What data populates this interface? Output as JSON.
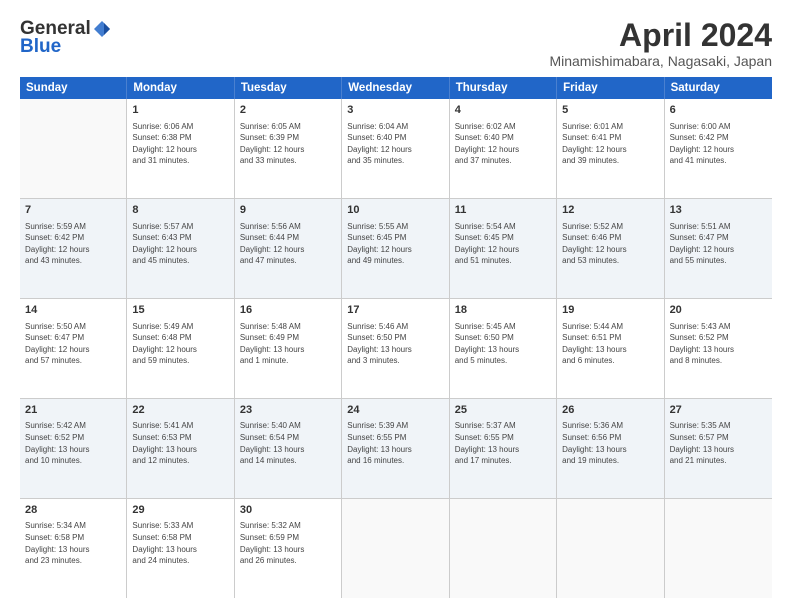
{
  "header": {
    "logo_general": "General",
    "logo_blue": "Blue",
    "title": "April 2024",
    "subtitle": "Minamishimabara, Nagasaki, Japan"
  },
  "calendar": {
    "days_of_week": [
      "Sunday",
      "Monday",
      "Tuesday",
      "Wednesday",
      "Thursday",
      "Friday",
      "Saturday"
    ],
    "rows": [
      [
        {
          "num": "",
          "info": ""
        },
        {
          "num": "1",
          "info": "Sunrise: 6:06 AM\nSunset: 6:38 PM\nDaylight: 12 hours\nand 31 minutes."
        },
        {
          "num": "2",
          "info": "Sunrise: 6:05 AM\nSunset: 6:39 PM\nDaylight: 12 hours\nand 33 minutes."
        },
        {
          "num": "3",
          "info": "Sunrise: 6:04 AM\nSunset: 6:40 PM\nDaylight: 12 hours\nand 35 minutes."
        },
        {
          "num": "4",
          "info": "Sunrise: 6:02 AM\nSunset: 6:40 PM\nDaylight: 12 hours\nand 37 minutes."
        },
        {
          "num": "5",
          "info": "Sunrise: 6:01 AM\nSunset: 6:41 PM\nDaylight: 12 hours\nand 39 minutes."
        },
        {
          "num": "6",
          "info": "Sunrise: 6:00 AM\nSunset: 6:42 PM\nDaylight: 12 hours\nand 41 minutes."
        }
      ],
      [
        {
          "num": "7",
          "info": "Sunrise: 5:59 AM\nSunset: 6:42 PM\nDaylight: 12 hours\nand 43 minutes."
        },
        {
          "num": "8",
          "info": "Sunrise: 5:57 AM\nSunset: 6:43 PM\nDaylight: 12 hours\nand 45 minutes."
        },
        {
          "num": "9",
          "info": "Sunrise: 5:56 AM\nSunset: 6:44 PM\nDaylight: 12 hours\nand 47 minutes."
        },
        {
          "num": "10",
          "info": "Sunrise: 5:55 AM\nSunset: 6:45 PM\nDaylight: 12 hours\nand 49 minutes."
        },
        {
          "num": "11",
          "info": "Sunrise: 5:54 AM\nSunset: 6:45 PM\nDaylight: 12 hours\nand 51 minutes."
        },
        {
          "num": "12",
          "info": "Sunrise: 5:52 AM\nSunset: 6:46 PM\nDaylight: 12 hours\nand 53 minutes."
        },
        {
          "num": "13",
          "info": "Sunrise: 5:51 AM\nSunset: 6:47 PM\nDaylight: 12 hours\nand 55 minutes."
        }
      ],
      [
        {
          "num": "14",
          "info": "Sunrise: 5:50 AM\nSunset: 6:47 PM\nDaylight: 12 hours\nand 57 minutes."
        },
        {
          "num": "15",
          "info": "Sunrise: 5:49 AM\nSunset: 6:48 PM\nDaylight: 12 hours\nand 59 minutes."
        },
        {
          "num": "16",
          "info": "Sunrise: 5:48 AM\nSunset: 6:49 PM\nDaylight: 13 hours\nand 1 minute."
        },
        {
          "num": "17",
          "info": "Sunrise: 5:46 AM\nSunset: 6:50 PM\nDaylight: 13 hours\nand 3 minutes."
        },
        {
          "num": "18",
          "info": "Sunrise: 5:45 AM\nSunset: 6:50 PM\nDaylight: 13 hours\nand 5 minutes."
        },
        {
          "num": "19",
          "info": "Sunrise: 5:44 AM\nSunset: 6:51 PM\nDaylight: 13 hours\nand 6 minutes."
        },
        {
          "num": "20",
          "info": "Sunrise: 5:43 AM\nSunset: 6:52 PM\nDaylight: 13 hours\nand 8 minutes."
        }
      ],
      [
        {
          "num": "21",
          "info": "Sunrise: 5:42 AM\nSunset: 6:52 PM\nDaylight: 13 hours\nand 10 minutes."
        },
        {
          "num": "22",
          "info": "Sunrise: 5:41 AM\nSunset: 6:53 PM\nDaylight: 13 hours\nand 12 minutes."
        },
        {
          "num": "23",
          "info": "Sunrise: 5:40 AM\nSunset: 6:54 PM\nDaylight: 13 hours\nand 14 minutes."
        },
        {
          "num": "24",
          "info": "Sunrise: 5:39 AM\nSunset: 6:55 PM\nDaylight: 13 hours\nand 16 minutes."
        },
        {
          "num": "25",
          "info": "Sunrise: 5:37 AM\nSunset: 6:55 PM\nDaylight: 13 hours\nand 17 minutes."
        },
        {
          "num": "26",
          "info": "Sunrise: 5:36 AM\nSunset: 6:56 PM\nDaylight: 13 hours\nand 19 minutes."
        },
        {
          "num": "27",
          "info": "Sunrise: 5:35 AM\nSunset: 6:57 PM\nDaylight: 13 hours\nand 21 minutes."
        }
      ],
      [
        {
          "num": "28",
          "info": "Sunrise: 5:34 AM\nSunset: 6:58 PM\nDaylight: 13 hours\nand 23 minutes."
        },
        {
          "num": "29",
          "info": "Sunrise: 5:33 AM\nSunset: 6:58 PM\nDaylight: 13 hours\nand 24 minutes."
        },
        {
          "num": "30",
          "info": "Sunrise: 5:32 AM\nSunset: 6:59 PM\nDaylight: 13 hours\nand 26 minutes."
        },
        {
          "num": "",
          "info": ""
        },
        {
          "num": "",
          "info": ""
        },
        {
          "num": "",
          "info": ""
        },
        {
          "num": "",
          "info": ""
        }
      ]
    ]
  }
}
